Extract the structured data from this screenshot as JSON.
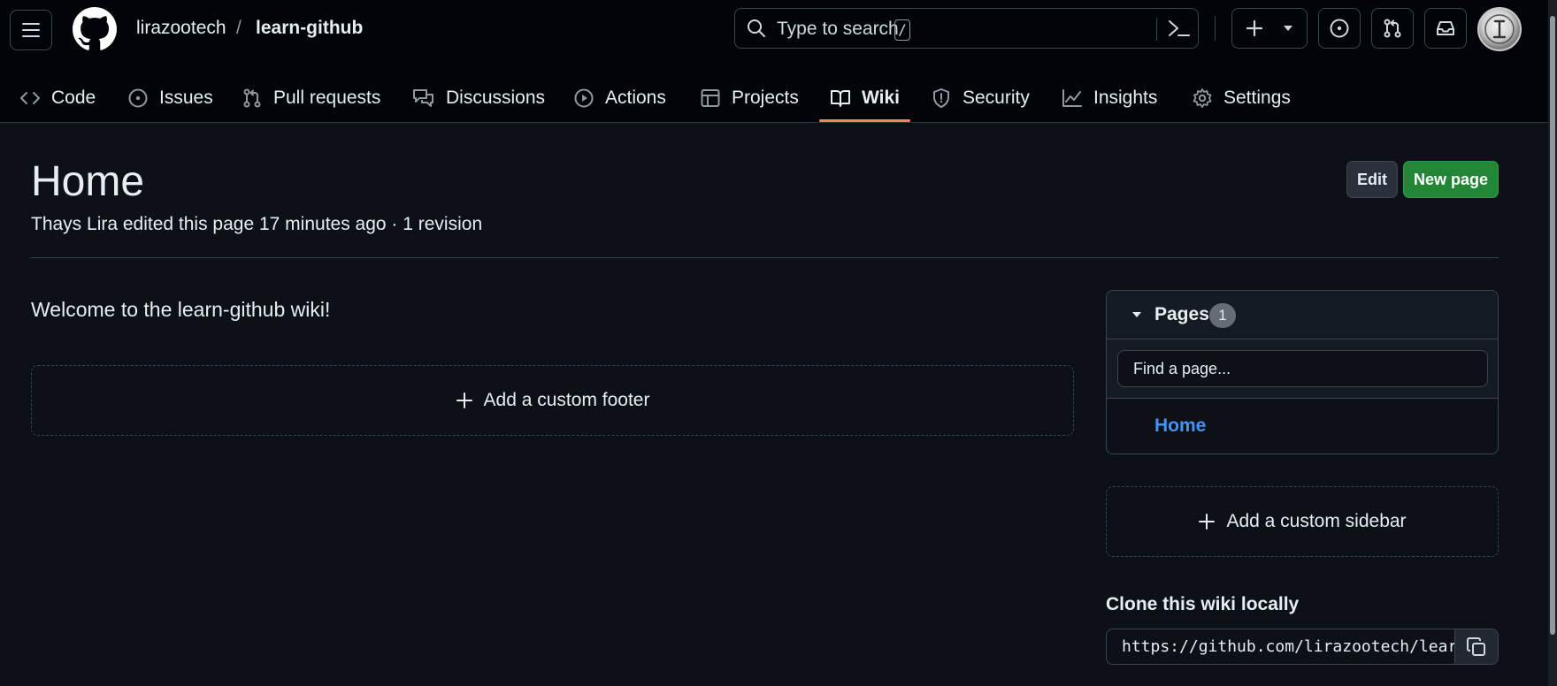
{
  "header": {
    "owner": "lirazootech",
    "separator": "/",
    "repo": "learn-github",
    "search_placeholder": "Type to search",
    "search_key": "/"
  },
  "tabs": [
    {
      "label": "Code",
      "icon": "code-icon"
    },
    {
      "label": "Issues",
      "icon": "issue-opened-icon"
    },
    {
      "label": "Pull requests",
      "icon": "git-pull-request-icon"
    },
    {
      "label": "Discussions",
      "icon": "comment-discussion-icon"
    },
    {
      "label": "Actions",
      "icon": "play-icon"
    },
    {
      "label": "Projects",
      "icon": "table-icon"
    },
    {
      "label": "Wiki",
      "icon": "book-icon",
      "active": true
    },
    {
      "label": "Security",
      "icon": "shield-icon"
    },
    {
      "label": "Insights",
      "icon": "graph-icon"
    },
    {
      "label": "Settings",
      "icon": "gear-icon"
    }
  ],
  "page": {
    "title": "Home",
    "meta": "Thays Lira edited this page 17 minutes ago · 1 revision",
    "edit_label": "Edit",
    "new_page_label": "New page",
    "body": "Welcome to the learn-github wiki!",
    "footer_label": "Add a custom footer"
  },
  "sidebar": {
    "pages_title": "Pages",
    "pages_count": "1",
    "find_placeholder": "Find a page...",
    "pages": [
      "Home"
    ],
    "custom_sidebar_label": "Add a custom sidebar",
    "clone_title": "Clone this wiki locally",
    "clone_url": "https://github.com/lirazootech/learn-github.wiki.git"
  },
  "colors": {
    "background": "#0d1117",
    "header_bg": "#010409",
    "accent_underline": "#f78166",
    "link": "#4493f8",
    "primary_button": "#238636"
  }
}
